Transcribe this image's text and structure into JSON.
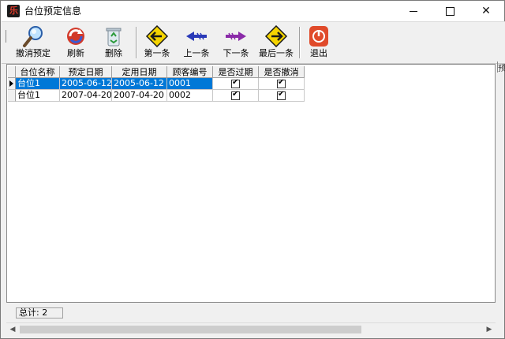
{
  "window": {
    "title": "台位预定信息",
    "app_icon_glyph": "乐"
  },
  "toolbar": {
    "buttons": [
      {
        "id": "cancel-reservation",
        "label": "撤消预定",
        "icon": "magnifier-icon"
      },
      {
        "id": "refresh",
        "label": "刷新",
        "icon": "refresh-icon"
      },
      {
        "id": "delete",
        "label": "删除",
        "icon": "recycle-bin-icon"
      },
      {
        "id": "first",
        "label": "第一条",
        "icon": "arrow-left-sign-icon"
      },
      {
        "id": "prev",
        "label": "上一条",
        "icon": "arrow-left-blue-icon"
      },
      {
        "id": "next",
        "label": "下一条",
        "icon": "arrow-right-purple-icon"
      },
      {
        "id": "last",
        "label": "最后一条",
        "icon": "arrow-right-sign-icon"
      },
      {
        "id": "exit",
        "label": "退出",
        "icon": "power-icon"
      }
    ],
    "right_stub": "预"
  },
  "grid": {
    "columns": [
      "台位名称",
      "预定日期",
      "定用日期",
      "顾客编号",
      "是否过期",
      "是否撤消"
    ],
    "rows": [
      {
        "table": "台位1",
        "reserve_date": "2005-06-12",
        "use_date": "2005-06-12",
        "customer": "0001",
        "expired": true,
        "cancelled": true,
        "selected": true
      },
      {
        "table": "台位1",
        "reserve_date": "2007-04-20",
        "use_date": "2007-04-20",
        "customer": "0002",
        "expired": true,
        "cancelled": true,
        "selected": false
      }
    ]
  },
  "status": {
    "total_text": "总计: 2"
  },
  "colors": {
    "selection": "#0078d7",
    "toolbar_bg": "#f0f0f0"
  }
}
